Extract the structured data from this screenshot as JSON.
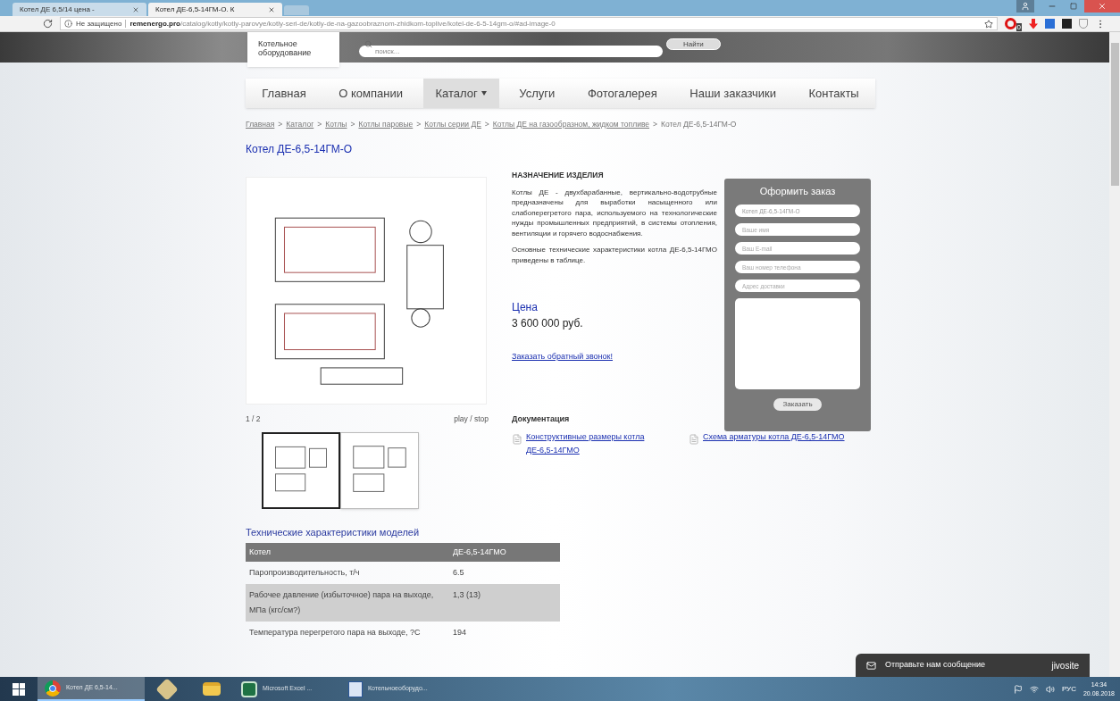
{
  "browser": {
    "tabs": [
      {
        "title": "Котел ДЕ 6,5/14 цена - ",
        "selected": false
      },
      {
        "title": "Котел ДЕ-6,5-14ГМ-О. К",
        "selected": true
      }
    ],
    "security": "Не защищено",
    "url_host": "remenergo.pro",
    "url_path": "/catalog/kotly/kotly-parovye/kotly-seri-de/kotly-de-na-gazoobraznom-zhidkom-toplive/kotel-de-6-5-14gm-o/#ad-image-0",
    "extension_badge": "0"
  },
  "header": {
    "logo_lines": [
      "Котельное",
      "оборудование"
    ],
    "search_placeholder": "поиск...",
    "search_button": "Найти"
  },
  "nav": [
    {
      "label": "Главная",
      "selected": false,
      "dropdown": false
    },
    {
      "label": "О компании",
      "selected": false,
      "dropdown": false
    },
    {
      "label": "Каталог",
      "selected": true,
      "dropdown": true
    },
    {
      "label": "Услуги",
      "selected": false,
      "dropdown": false
    },
    {
      "label": "Фотогалерея",
      "selected": false,
      "dropdown": false
    },
    {
      "label": "Наши заказчики",
      "selected": false,
      "dropdown": false
    },
    {
      "label": "Контакты",
      "selected": false,
      "dropdown": false
    }
  ],
  "breadcrumbs": {
    "links": [
      "Главная",
      "Каталог",
      "Котлы",
      "Котлы паровые",
      "Котлы серии ДЕ",
      "Котлы ДЕ на газообразном, жидком топливе"
    ],
    "separator": ">",
    "current": "Котел ДЕ-6,5-14ГМ-О"
  },
  "title": "Котел ДЕ-6,5-14ГМ-О",
  "gallery": {
    "counter": "1 / 2",
    "play_stop": "play / stop",
    "thumbnails": [
      {
        "selected": true
      },
      {
        "selected": false
      }
    ]
  },
  "description": {
    "heading": "НАЗНАЧЕНИЕ ИЗДЕЛИЯ",
    "paragraphs": [
      "Котлы ДЕ - двухбарабанные, вертикально-водотрубные предназначены для выработки насыщенного или слабоперегретого пара, используемого на технологические нужды промышленных предприятий, в системы отопления, вентиляции и горячего водоснабжения.",
      "Основные технические характеристики котла ДЕ-6,5-14ГМО приведены в таблице."
    ],
    "price_label": "Цена",
    "price": "3 600 000 руб.",
    "callback_link": "Заказать обратный звонок!"
  },
  "order_form": {
    "title": "Оформить заказ",
    "fields": [
      {
        "value": "Котел ДЕ-6,5-14ГМ-О"
      },
      {
        "placeholder": "Ваше имя"
      },
      {
        "placeholder": "Ваш E-mail"
      },
      {
        "placeholder": "Ваш номер телефона"
      },
      {
        "placeholder": "Адрес доставки"
      }
    ],
    "button": "Заказать"
  },
  "documentation": {
    "heading": "Документация",
    "links": [
      "Конструктивные размеры котла ДЕ-6,5-14ГМО",
      "Схема арматуры котла ДЕ-6,5-14ГМО"
    ]
  },
  "specs": {
    "heading": "Технические характеристики моделей",
    "columns": [
      "Котел",
      "ДЕ-6,5-14ГМО"
    ],
    "rows": [
      [
        "Паропроизводительность, т/ч",
        "6.5"
      ],
      [
        "Рабочее давление (избыточное) пара на выходе, МПа (кгс/см?)",
        "1,3 (13)"
      ],
      [
        "Температура перегретого пара на выходе, ?С",
        "194"
      ]
    ]
  },
  "chat": {
    "label": "Отправьте нам сообщение",
    "brand": "jivosite"
  },
  "taskbar": {
    "items": [
      {
        "label": "Котел ДЕ 6,5-14...",
        "kind": "browser",
        "selected": true
      },
      {
        "kind": "plugin",
        "selected": false
      },
      {
        "kind": "folder",
        "selected": false
      },
      {
        "label": "Microsoft Excel ...",
        "kind": "excel",
        "selected": false
      },
      {
        "label": "Котельноеоборудо...",
        "kind": "doc",
        "selected": false
      }
    ],
    "language": "РУС",
    "time": "14:34",
    "date": "20.08.2018"
  }
}
